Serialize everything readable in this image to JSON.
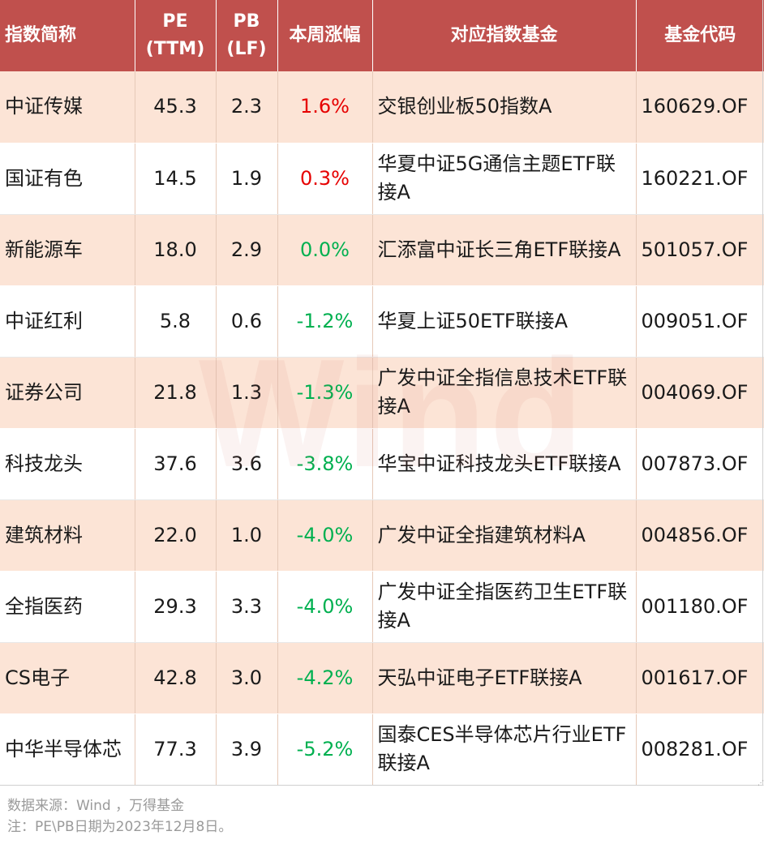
{
  "header": {
    "name": "指数简称",
    "pe": [
      "PE",
      "(TTM)"
    ],
    "pb": [
      "PB",
      "(LF)"
    ],
    "weekly": "本周涨幅",
    "fund": "对应指数基金",
    "code": "基金代码"
  },
  "watermark": "Wind",
  "rows": [
    {
      "name": "中证传媒",
      "pe": "45.3",
      "pb": "2.3",
      "weekly": "1.6%",
      "trend": "up",
      "fund": "交银创业板50指数A",
      "code": "160629.OF"
    },
    {
      "name": "国证有色",
      "pe": "14.5",
      "pb": "1.9",
      "weekly": "0.3%",
      "trend": "up",
      "fund": "华夏中证5G通信主题ETF联接A",
      "code": "160221.OF"
    },
    {
      "name": "新能源车",
      "pe": "18.0",
      "pb": "2.9",
      "weekly": "0.0%",
      "trend": "zero",
      "fund": "汇添富中证长三角ETF联接A",
      "code": "501057.OF"
    },
    {
      "name": "中证红利",
      "pe": "5.8",
      "pb": "0.6",
      "weekly": "-1.2%",
      "trend": "down",
      "fund": "华夏上证50ETF联接A",
      "code": "009051.OF"
    },
    {
      "name": "证券公司",
      "pe": "21.8",
      "pb": "1.3",
      "weekly": "-1.3%",
      "trend": "down",
      "fund": "广发中证全指信息技术ETF联接A",
      "code": "004069.OF"
    },
    {
      "name": "科技龙头",
      "pe": "37.6",
      "pb": "3.6",
      "weekly": "-3.8%",
      "trend": "down",
      "fund": "华宝中证科技龙头ETF联接A",
      "code": "007873.OF"
    },
    {
      "name": "建筑材料",
      "pe": "22.0",
      "pb": "1.0",
      "weekly": "-4.0%",
      "trend": "down",
      "fund": "广发中证全指建筑材料A",
      "code": "004856.OF"
    },
    {
      "name": "全指医药",
      "pe": "29.3",
      "pb": "3.3",
      "weekly": "-4.0%",
      "trend": "down",
      "fund": "广发中证全指医药卫生ETF联接A",
      "code": "001180.OF"
    },
    {
      "name": "CS电子",
      "pe": "42.8",
      "pb": "3.0",
      "weekly": "-4.2%",
      "trend": "down",
      "fund": "天弘中证电子ETF联接A",
      "code": "001617.OF"
    },
    {
      "name": "中华半导体芯",
      "pe": "77.3",
      "pb": "3.9",
      "weekly": "-5.2%",
      "trend": "down",
      "fund": "国泰CES半导体芯片行业ETF联接A",
      "code": "008281.OF"
    }
  ],
  "colors": {
    "header_bg": "#c0504d",
    "row_shade": "#fce4d6",
    "up": "#e60000",
    "down": "#00b050"
  },
  "footnotes": {
    "source": "数据来源：Wind   ，万得基金",
    "note": "注：PE\\PB日期为2023年12月8日。"
  }
}
